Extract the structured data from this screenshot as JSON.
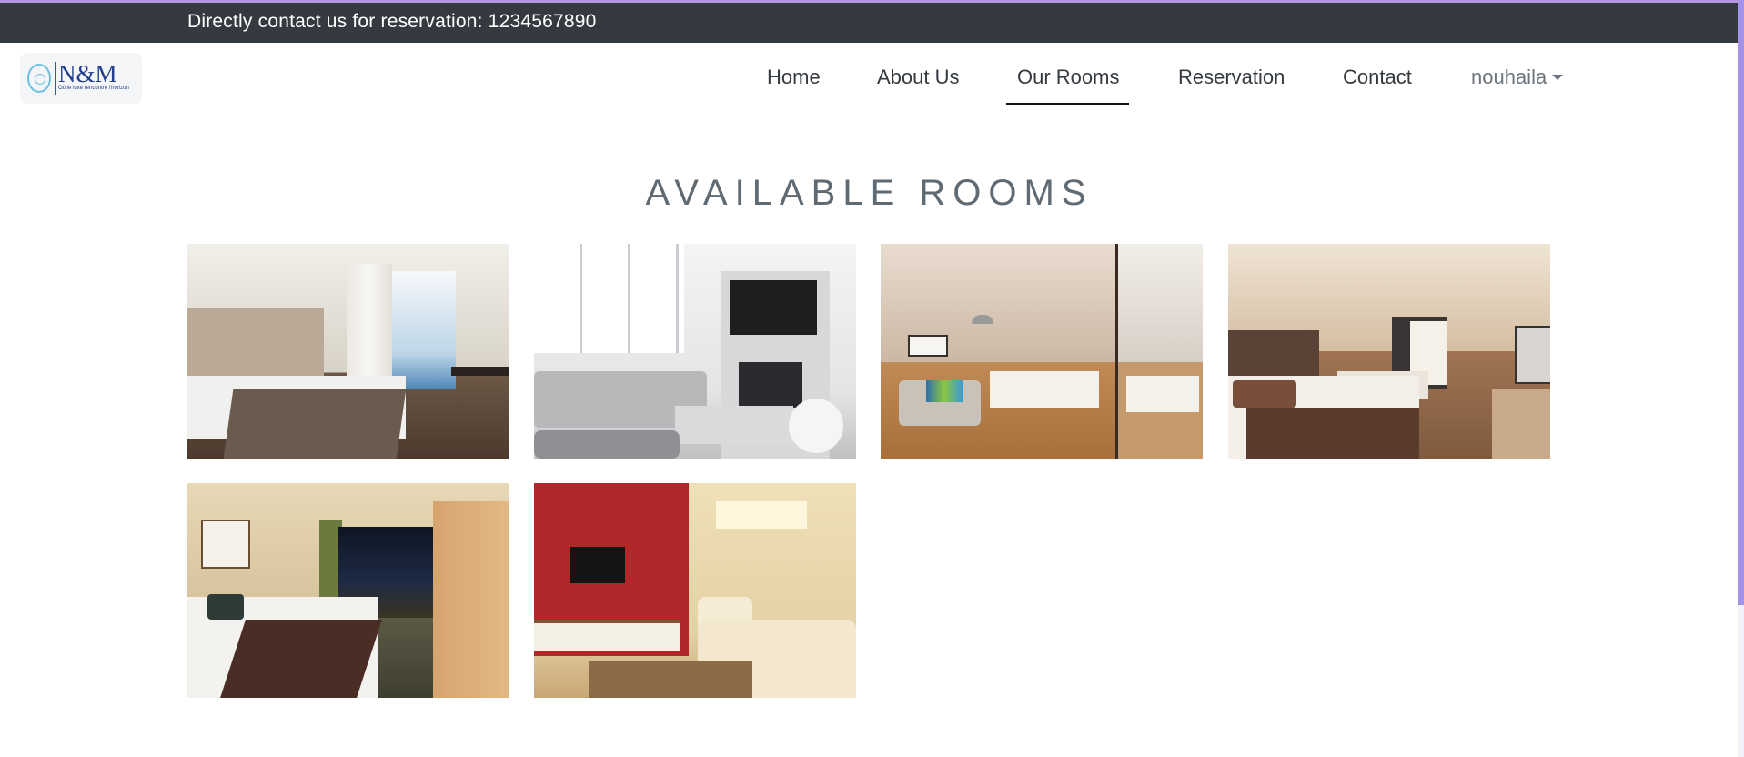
{
  "topbar": {
    "contact_text": "Directly contact us for reservation: 1234567890"
  },
  "brand": {
    "logo_text": "N&M",
    "tagline": "Où le luxe rencontre l'horizon"
  },
  "nav": {
    "items": [
      {
        "label": "Home"
      },
      {
        "label": "About Us"
      },
      {
        "label": "Our Rooms",
        "active": true
      },
      {
        "label": "Reservation"
      },
      {
        "label": "Contact"
      }
    ],
    "user_label": "nouhaila"
  },
  "page": {
    "heading": "AVAILABLE ROOMS"
  },
  "rooms": [
    {
      "alt": "hotel room with balcony"
    },
    {
      "alt": "modern living room with TV"
    },
    {
      "alt": "bedroom with mirror wall"
    },
    {
      "alt": "double bedroom with brown runner"
    },
    {
      "alt": "bedroom with city view window"
    },
    {
      "alt": "living room with red wall"
    }
  ],
  "colors": {
    "topbar_bg": "#343a40",
    "accent_line": "#b497e0",
    "heading": "#5f6a73",
    "nav_text": "#343a40"
  },
  "icons": {
    "user_dropdown": "caret-down-icon",
    "logo": "emblem-icon"
  }
}
